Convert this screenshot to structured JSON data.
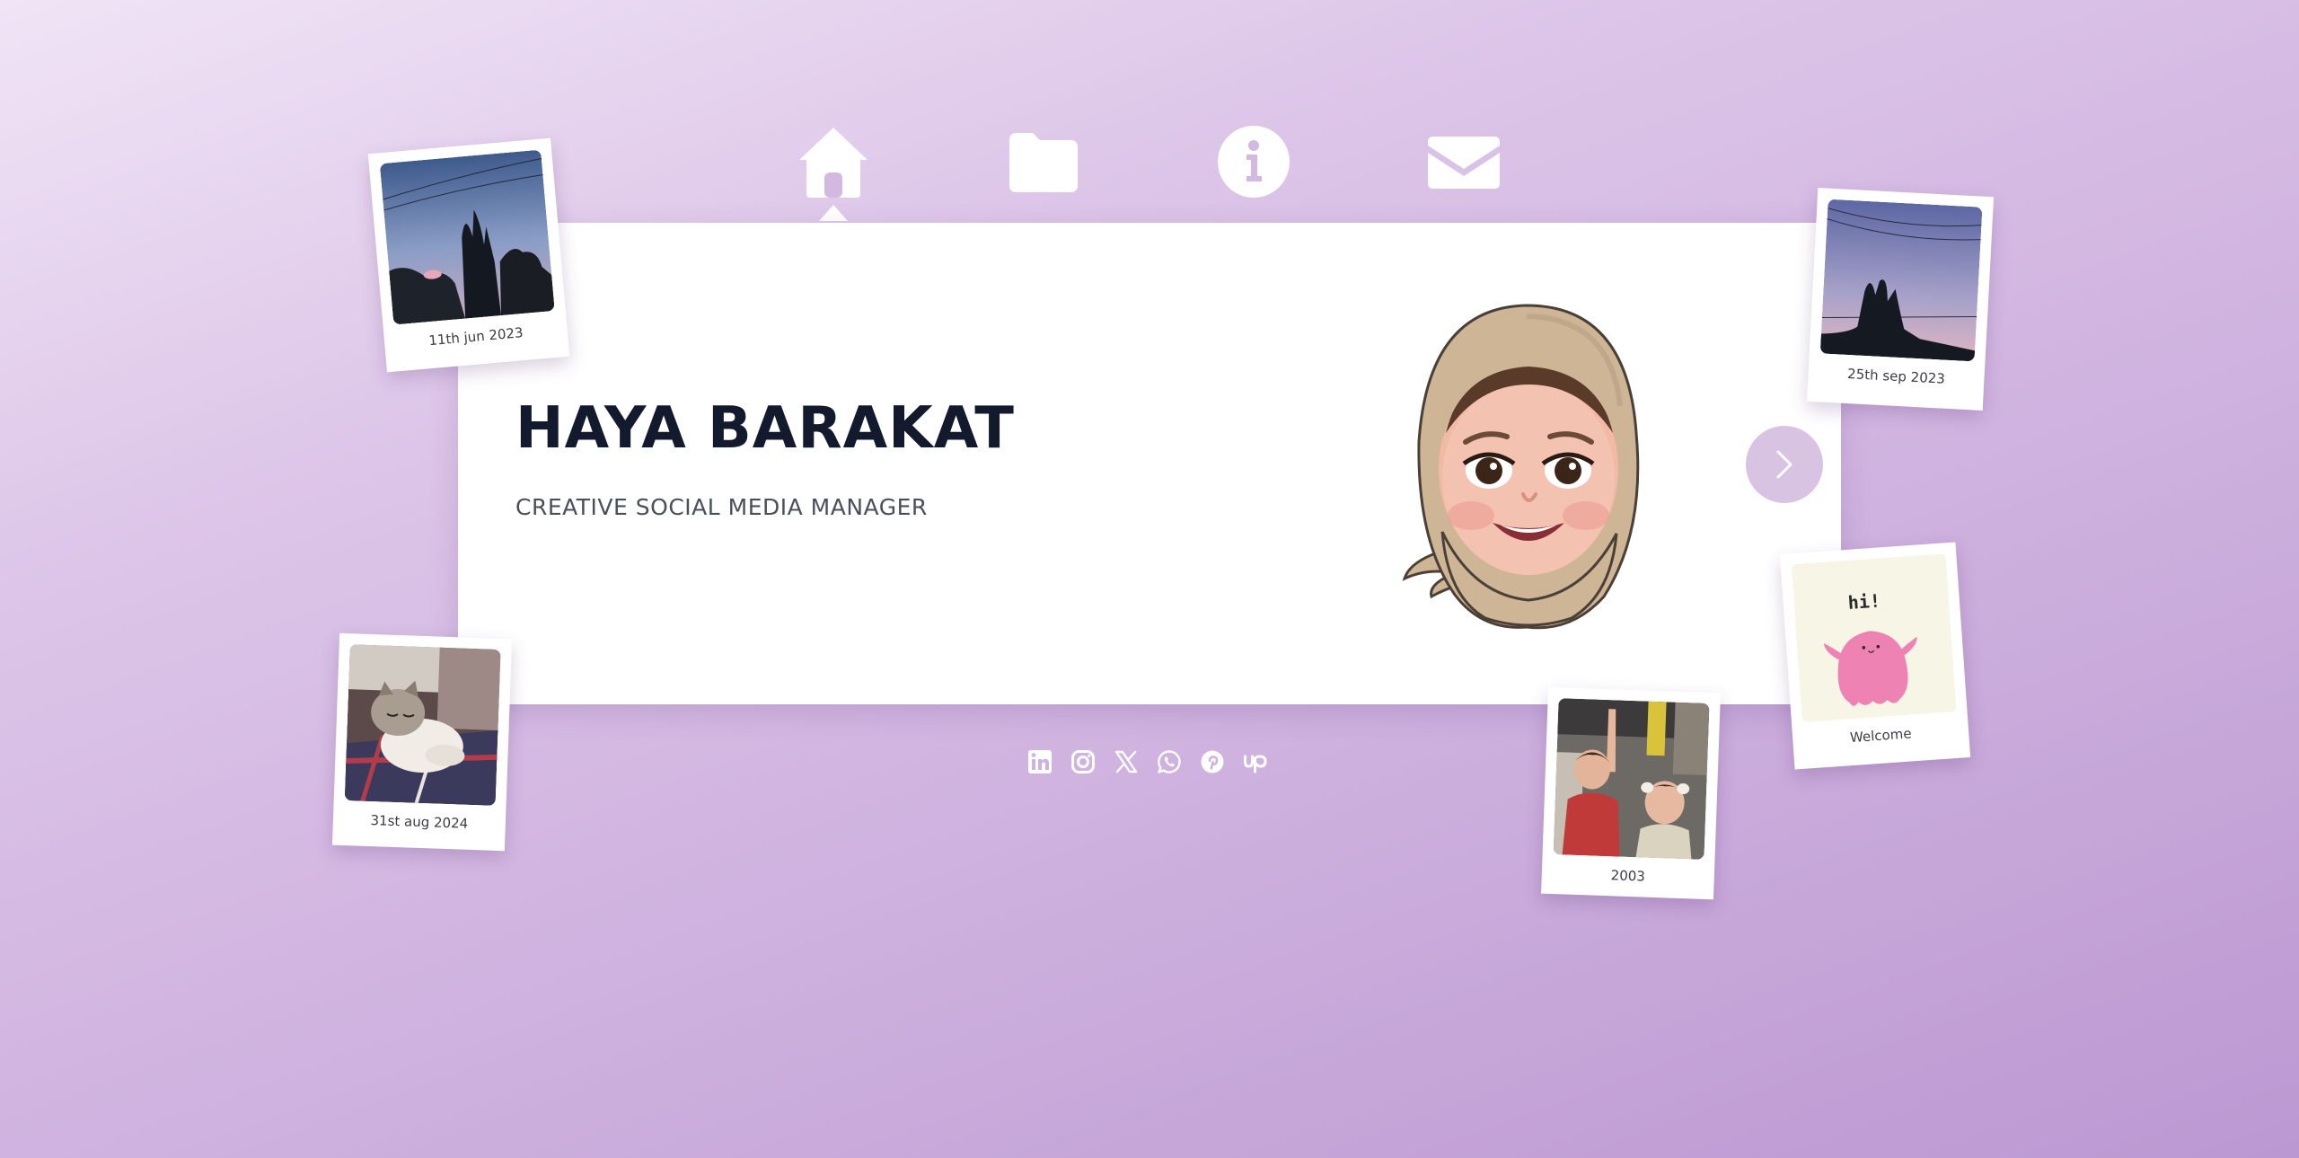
{
  "nav": {
    "items": [
      {
        "icon": "home-icon",
        "active": true
      },
      {
        "icon": "folder-icon",
        "active": false
      },
      {
        "icon": "info-icon",
        "active": false
      },
      {
        "icon": "mail-icon",
        "active": false
      }
    ]
  },
  "hero": {
    "name": "HAYA BARAKAT",
    "title": "CREATIVE SOCIAL MEDIA MANAGER",
    "avatar_icon": "memoji-avatar"
  },
  "carousel": {
    "next_icon": "chevron-right-icon"
  },
  "social": {
    "links": [
      {
        "icon": "linkedin-icon"
      },
      {
        "icon": "instagram-icon"
      },
      {
        "icon": "x-icon"
      },
      {
        "icon": "whatsapp-icon"
      },
      {
        "icon": "pinterest-icon"
      },
      {
        "icon": "upwork-icon"
      }
    ]
  },
  "polaroids": [
    {
      "caption": "11th jun 2023",
      "image": "evening sky with trees"
    },
    {
      "caption": "25th sep 2023",
      "image": "dusk sky with cypress trees"
    },
    {
      "caption": "31st aug 2024",
      "image": "cat sleeping on blanket"
    },
    {
      "caption": "2003",
      "image": "two children photo"
    },
    {
      "caption": "Welcome",
      "image_text": "hi!"
    }
  ],
  "colors": {
    "background_start": "#f1e4f6",
    "background_end": "#bc98d2",
    "card": "#ffffff",
    "name_text": "#141a2e",
    "role_text": "#4a4f5c",
    "next_button": "#d8c3e3"
  }
}
